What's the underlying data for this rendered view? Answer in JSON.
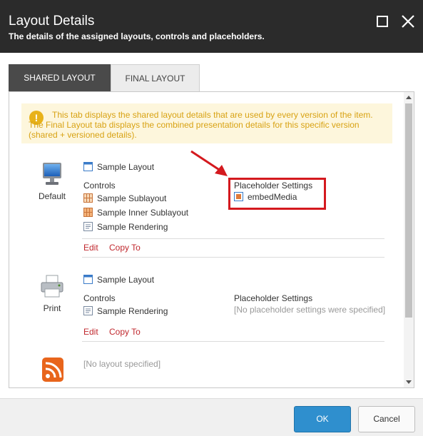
{
  "dialog": {
    "title": "Layout Details",
    "subtitle": "The details of the assigned layouts, controls and placeholders."
  },
  "tabs": [
    {
      "label": "SHARED LAYOUT",
      "active": true
    },
    {
      "label": "FINAL LAYOUT",
      "active": false
    }
  ],
  "notice": {
    "icon": "warning-icon",
    "text": "This tab displays the shared layout details that are used by every version of the item. The Final Layout tab displays the combined presentation details for this specific version (shared + versioned details)."
  },
  "devices": [
    {
      "name": "Default",
      "icon": "monitor-icon",
      "layout": "Sample Layout",
      "controls_label": "Controls",
      "controls": [
        "Sample Sublayout",
        "Sample Inner Sublayout",
        "Sample Rendering"
      ],
      "placeholder_label": "Placeholder Settings",
      "placeholder_value": "embedMedia",
      "edit_label": "Edit",
      "copy_label": "Copy To"
    },
    {
      "name": "Print",
      "icon": "printer-icon",
      "layout": "Sample Layout",
      "controls_label": "Controls",
      "controls": [
        "Sample Rendering"
      ],
      "placeholder_label": "Placeholder Settings",
      "placeholder_value": "[No placeholder settings were specified]",
      "edit_label": "Edit",
      "copy_label": "Copy To"
    },
    {
      "name": "",
      "icon": "rss-feed-icon",
      "layout": "[No layout specified]"
    }
  ],
  "buttons": {
    "ok": "OK",
    "cancel": "Cancel"
  },
  "colors": {
    "header_bg": "#2b2b2b",
    "accent_link": "#c0282e",
    "primary_button": "#2f8fce",
    "highlight": "#d4191e",
    "notice_text": "#d8a213"
  }
}
